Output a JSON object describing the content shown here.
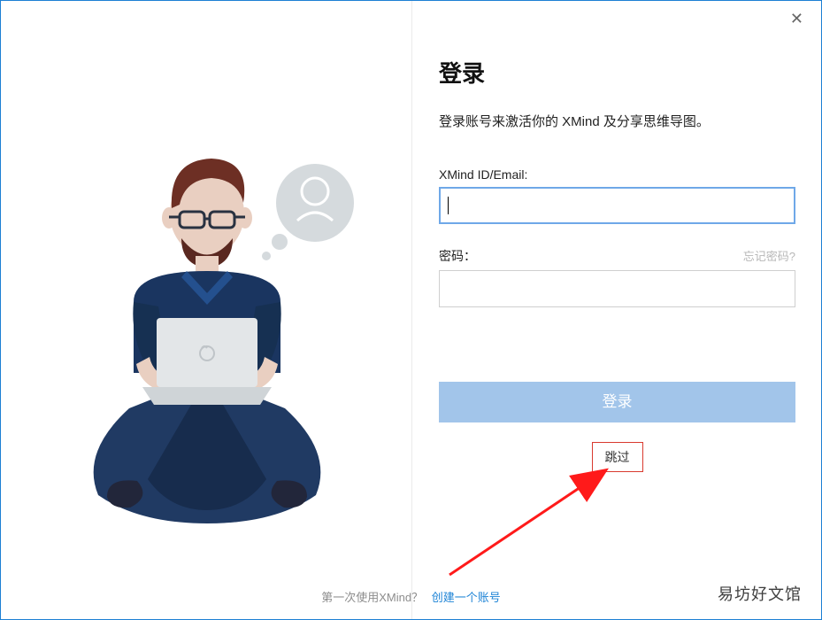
{
  "close_label": "✕",
  "title": "登录",
  "subtitle": "登录账号来激活你的 XMind 及分享思维导图。",
  "id_field": {
    "label": "XMind ID/Email:",
    "value": ""
  },
  "password_field": {
    "label": "密码：",
    "value": ""
  },
  "forgot_password": "忘记密码?",
  "login_button": "登录",
  "skip_button": "跳过",
  "footer": {
    "question": "第一次使用XMind？",
    "create_link": "创建一个账号"
  },
  "watermark": "易坊好文馆"
}
